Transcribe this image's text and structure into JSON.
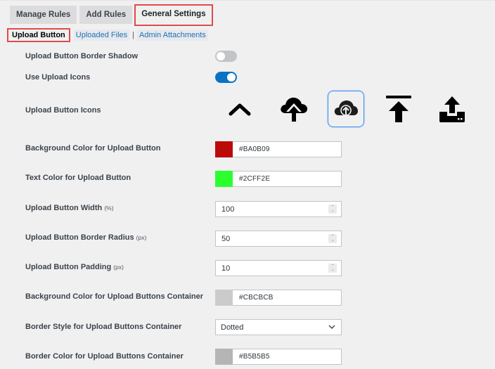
{
  "tabs": [
    {
      "label": "Manage Rules",
      "active": false
    },
    {
      "label": "Add Rules",
      "active": false
    },
    {
      "label": "General Settings",
      "active": true
    }
  ],
  "subnav": {
    "current": "Upload Button",
    "links": [
      "Uploaded Files",
      "Admin Attachments"
    ],
    "separator": "|"
  },
  "settings": {
    "border_shadow": {
      "label": "Upload Button Border Shadow",
      "enabled": false
    },
    "use_icons": {
      "label": "Use Upload Icons",
      "enabled": true
    },
    "icons": {
      "label": "Upload Button Icons",
      "options": [
        "chevron-up-icon",
        "cloud-upload-arrow-icon",
        "cloud-upload-circle-icon",
        "upload-to-top-icon",
        "upload-tray-icon"
      ],
      "selected_index": 2
    },
    "bg_color": {
      "label": "Background Color for Upload Button",
      "value": "#BA0B09",
      "swatch": "#BA0B09"
    },
    "text_color": {
      "label": "Text Color for Upload Button",
      "value": "#2CFF2E",
      "swatch": "#2CFF2E"
    },
    "width": {
      "label": "Upload Button Width",
      "unit": "(%)",
      "value": "100"
    },
    "radius": {
      "label": "Upload Button Border Radius",
      "unit": "(px)",
      "value": "50"
    },
    "padding": {
      "label": "Upload Button Padding",
      "unit": "(px)",
      "value": "10"
    },
    "container_bg": {
      "label": "Background Color for Upload Buttons Container",
      "value": "#CBCBCB",
      "swatch": "#CBCBCB"
    },
    "container_border_style": {
      "label": "Border Style for Upload Buttons Container",
      "value": "Dotted"
    },
    "container_border_color": {
      "label": "Border Color for Upload Buttons Container",
      "value": "#B5B5B5",
      "swatch": "#B5B5B5"
    }
  },
  "colors": {
    "accent": "#0a73c4",
    "highlight": "#e04b4b",
    "link": "#2271b1"
  }
}
